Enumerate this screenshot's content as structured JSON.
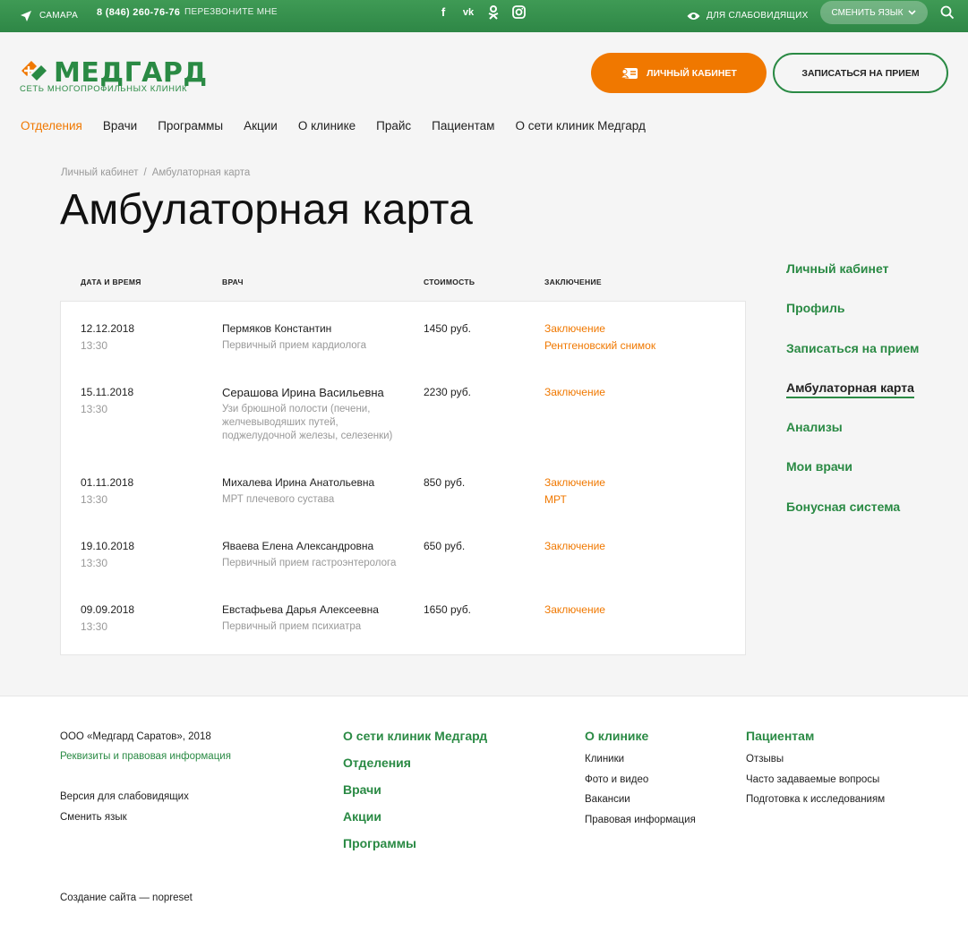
{
  "topbar": {
    "city": "САМАРА",
    "phone": "8 (846) 260-76-76",
    "callback": "ПЕРЕЗВОНИТЕ МНЕ",
    "social": [
      "f",
      "vk",
      "ok",
      "ig"
    ],
    "vision": "ДЛЯ СЛАБОВИДЯЩИХ",
    "lang_button": "СМЕНИТЬ ЯЗЫК"
  },
  "logo": {
    "name": "МЕДГАРД",
    "tagline": "СЕТЬ МНОГОПРОФИЛЬНЫХ КЛИНИК"
  },
  "header": {
    "cabinet_button": "ЛИЧНЫЙ КАБИНЕТ",
    "appointment_button": "ЗАПИСАТЬСЯ НА ПРИЕМ"
  },
  "nav": [
    {
      "label": "Отделения",
      "active": true
    },
    {
      "label": "Врачи"
    },
    {
      "label": "Программы"
    },
    {
      "label": "Акции"
    },
    {
      "label": "О клинике"
    },
    {
      "label": "Прайс"
    },
    {
      "label": "Пациентам"
    },
    {
      "label": "О сети клиник Медгард"
    }
  ],
  "breadcrumb": {
    "parent": "Личный кабинет",
    "sep": "/",
    "current": "Амбулаторная карта"
  },
  "page_title": "Амбулаторная карта",
  "table": {
    "headers": {
      "date": "ДАТА И ВРЕМЯ",
      "doctor": "ВРАЧ",
      "cost": "СТОИМОСТЬ",
      "conclusion": "ЗАКЛЮЧЕНИЕ"
    },
    "rows": [
      {
        "date": "12.12.2018",
        "time": "13:30",
        "doctor": "Пермяков Константин",
        "service": "Первичный прием кардиолога",
        "cost": "1450 руб.",
        "links": [
          "Заключение",
          "Рентгеновский снимок"
        ]
      },
      {
        "date": "15.11.2018",
        "time": "13:30",
        "doctor": "Серашова Ирина Васильевна",
        "service": "Узи брюшной полости (печени, желчевыводяших путей, поджелудочной железы, селезенки)",
        "cost": "2230 руб.",
        "links": [
          "Заключение"
        ]
      },
      {
        "date": "01.11.2018",
        "time": "13:30",
        "doctor": "Михалева Ирина Анатольевна",
        "service": "МРТ плечевого сустава",
        "cost": "850 руб.",
        "links": [
          "Заключение",
          "МРТ"
        ]
      },
      {
        "date": "19.10.2018",
        "time": "13:30",
        "doctor": "Яваева Елена Александровна",
        "service": "Первичный прием гастроэнтеролога",
        "cost": "650 руб.",
        "links": [
          "Заключение"
        ]
      },
      {
        "date": "09.09.2018",
        "time": "13:30",
        "doctor": "Евстафьева Дарья Алексеевна",
        "service": "Первичный прием психиатра",
        "cost": "1650 руб.",
        "links": [
          "Заключение"
        ]
      }
    ]
  },
  "sidemenu": [
    {
      "label": "Личный кабинет"
    },
    {
      "label": "Профиль"
    },
    {
      "label": "Записаться на прием"
    },
    {
      "label": "Амбулаторная карта",
      "active": true
    },
    {
      "label": "Анализы"
    },
    {
      "label": "Мои врачи"
    },
    {
      "label": "Бонусная система"
    }
  ],
  "footer": {
    "copyright": "ООО «Медгард Саратов», 2018",
    "requisites": "Реквизиты и правовая информация",
    "low_vision": "Версия для слабовидящих",
    "change_lang": "Сменить язык",
    "made_by": "Создание сайта — nopreset",
    "col2": [
      "О сети клиник Медгард",
      "Отделения",
      "Врачи",
      "Акции",
      "Программы"
    ],
    "col3": {
      "title": "О клинике",
      "links": [
        "Клиники",
        "Фото и видео",
        "Вакансии",
        "Правовая информация"
      ]
    },
    "col4": {
      "title": "Пациентам",
      "links": [
        "Отзывы",
        "Часто задаваемые вопросы",
        "Подготовка к исследованиям"
      ]
    }
  },
  "colors": {
    "green": "#2a8a44",
    "orange": "#f07800"
  }
}
